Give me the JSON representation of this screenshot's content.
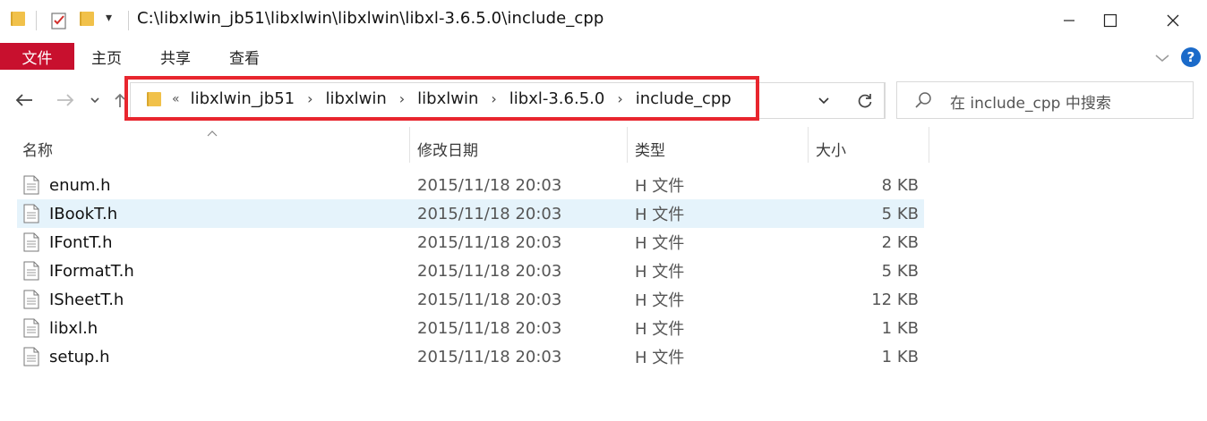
{
  "window": {
    "title": "C:\\libxlwin_jb51\\libxlwin\\libxlwin\\libxl-3.6.5.0\\include_cpp"
  },
  "quick_access": {
    "dropdown_glyph": "▾"
  },
  "ribbon": {
    "file_tab": "文件",
    "tabs": [
      "主页",
      "共享",
      "查看"
    ],
    "help": "?"
  },
  "address": {
    "overflow": "«",
    "crumbs": [
      "libxlwin_jb51",
      "libxlwin",
      "libxlwin",
      "libxl-3.6.5.0",
      "include_cpp"
    ]
  },
  "search": {
    "placeholder": "在 include_cpp 中搜索"
  },
  "columns": {
    "name": "名称",
    "date": "修改日期",
    "type": "类型",
    "size": "大小"
  },
  "files": [
    {
      "name": "enum.h",
      "date": "2015/11/18 20:03",
      "type": "H 文件",
      "size": "8 KB"
    },
    {
      "name": "IBookT.h",
      "date": "2015/11/18 20:03",
      "type": "H 文件",
      "size": "5 KB"
    },
    {
      "name": "IFontT.h",
      "date": "2015/11/18 20:03",
      "type": "H 文件",
      "size": "2 KB"
    },
    {
      "name": "IFormatT.h",
      "date": "2015/11/18 20:03",
      "type": "H 文件",
      "size": "5 KB"
    },
    {
      "name": "ISheetT.h",
      "date": "2015/11/18 20:03",
      "type": "H 文件",
      "size": "12 KB"
    },
    {
      "name": "libxl.h",
      "date": "2015/11/18 20:03",
      "type": "H 文件",
      "size": "1 KB"
    },
    {
      "name": "setup.h",
      "date": "2015/11/18 20:03",
      "type": "H 文件",
      "size": "1 KB"
    }
  ],
  "colors": {
    "file_tab_bg": "#c8102e",
    "highlight_border": "#e8262e",
    "selected_row": "#e5f3fb",
    "help_bg": "#1b6ac9"
  }
}
